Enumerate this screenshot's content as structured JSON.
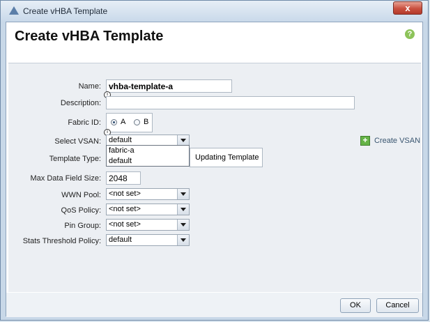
{
  "window": {
    "title": "Create vHBA Template"
  },
  "header": {
    "title": "Create vHBA Template",
    "help_label": "?"
  },
  "form": {
    "name": {
      "label": "Name:",
      "value": "vhba-template-a"
    },
    "description": {
      "label": "Description:",
      "value": ""
    },
    "fabric": {
      "label": "Fabric ID:",
      "options": [
        "A",
        "B"
      ],
      "selected": "A"
    },
    "vsan": {
      "label": "Select VSAN:",
      "value": "default",
      "options": [
        "fabric-a",
        "default"
      ]
    },
    "template_type": {
      "label": "Template Type:",
      "value": "Updating Template"
    },
    "max_data_field_size": {
      "label": "Max Data Field Size:",
      "value": "2048"
    },
    "wwn_pool": {
      "label": "WWN Pool:",
      "value": "<not set>"
    },
    "qos_policy": {
      "label": "QoS Policy:",
      "value": "<not set>"
    },
    "pin_group": {
      "label": "Pin Group:",
      "value": "<not set>"
    },
    "stats_threshold_policy": {
      "label": "Stats Threshold Policy:",
      "value": "default"
    }
  },
  "actions": {
    "create_vsan": "Create VSAN",
    "ok": "OK",
    "cancel": "Cancel",
    "close": "x"
  }
}
